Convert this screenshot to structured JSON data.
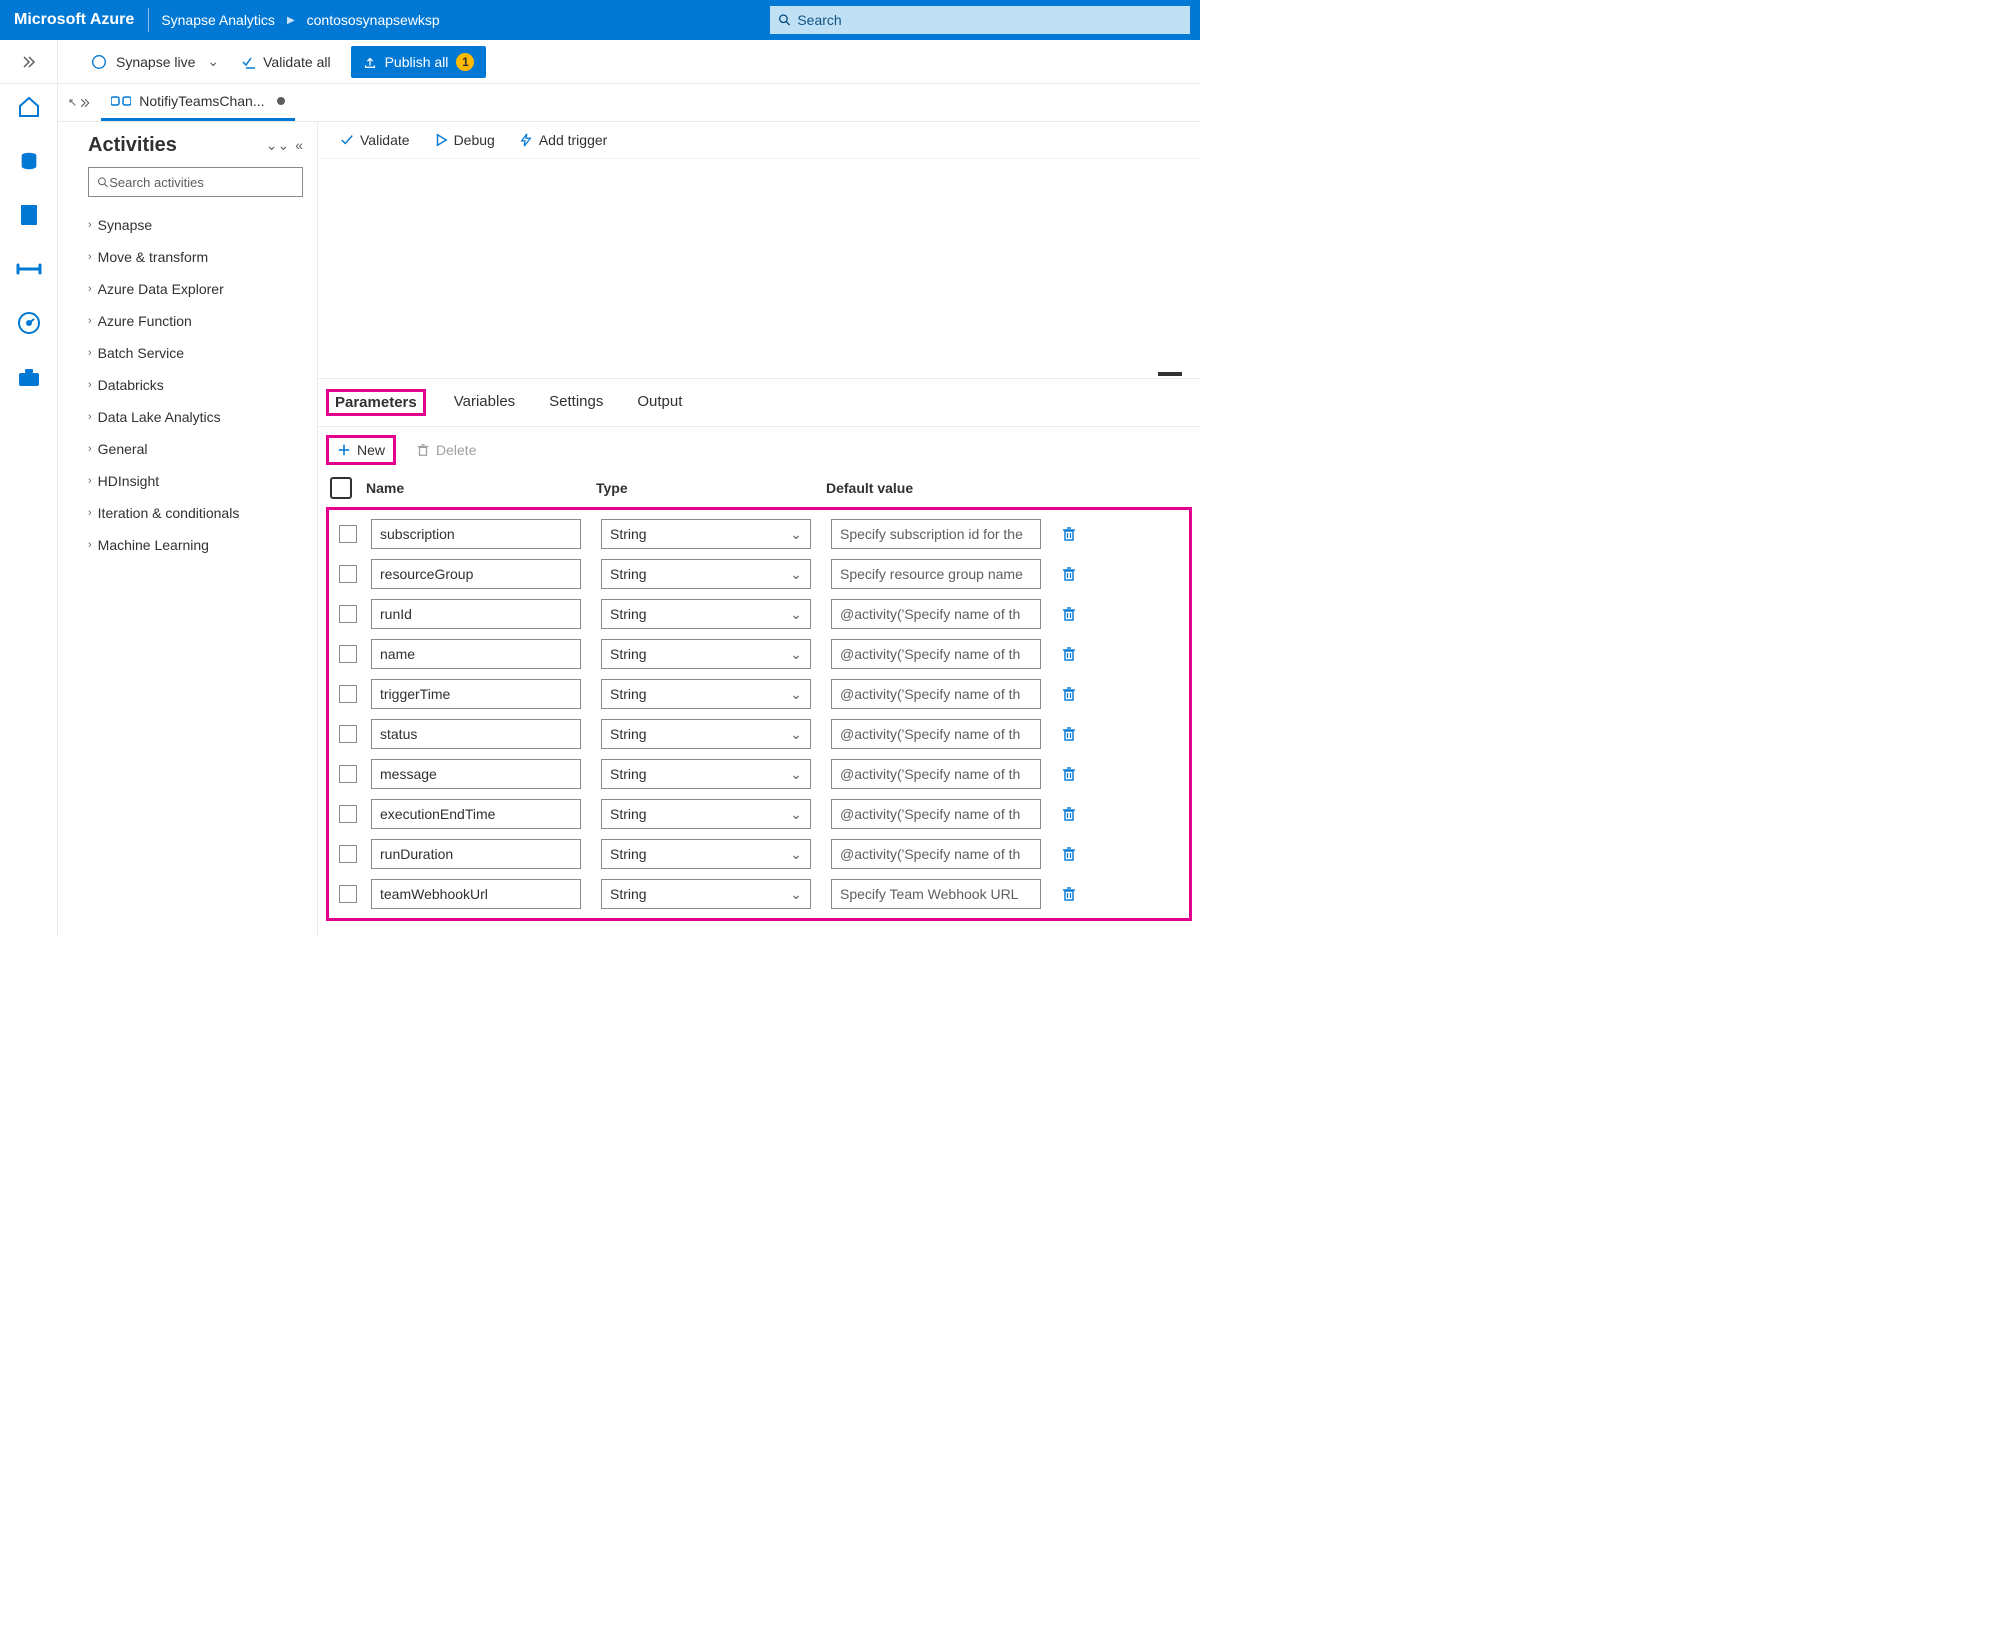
{
  "header": {
    "brand": "Microsoft Azure",
    "service": "Synapse Analytics",
    "workspace": "contososynapsewksp",
    "search_placeholder": "Search"
  },
  "cmdbar": {
    "mode_label": "Synapse live",
    "validate_all": "Validate all",
    "publish_all": "Publish all",
    "publish_badge": "1"
  },
  "pipeline_tab": {
    "name": "NotifiyTeamsChan..."
  },
  "canvas_toolbar": {
    "validate": "Validate",
    "debug": "Debug",
    "add_trigger": "Add trigger"
  },
  "activities": {
    "title": "Activities",
    "search_placeholder": "Search activities",
    "groups": [
      "Synapse",
      "Move & transform",
      "Azure Data Explorer",
      "Azure Function",
      "Batch Service",
      "Databricks",
      "Data Lake Analytics",
      "General",
      "HDInsight",
      "Iteration & conditionals",
      "Machine Learning"
    ]
  },
  "config": {
    "tabs": {
      "parameters": "Parameters",
      "variables": "Variables",
      "settings": "Settings",
      "output": "Output"
    },
    "new_label": "New",
    "delete_label": "Delete",
    "columns": {
      "name": "Name",
      "type": "Type",
      "default": "Default value"
    },
    "type_option": "String",
    "rows": [
      {
        "name": "subscription",
        "default": "Specify subscription id for the"
      },
      {
        "name": "resourceGroup",
        "default": "Specify resource group name"
      },
      {
        "name": "runId",
        "default": "@activity('Specify name of th"
      },
      {
        "name": "name",
        "default": "@activity('Specify name of th"
      },
      {
        "name": "triggerTime",
        "default": "@activity('Specify name of th"
      },
      {
        "name": "status",
        "default": "@activity('Specify name of th"
      },
      {
        "name": "message",
        "default": "@activity('Specify name of th"
      },
      {
        "name": "executionEndTime",
        "default": "@activity('Specify name of th"
      },
      {
        "name": "runDuration",
        "default": "@activity('Specify name of th"
      },
      {
        "name": "teamWebhookUrl",
        "default": "Specify Team Webhook URL"
      }
    ]
  }
}
